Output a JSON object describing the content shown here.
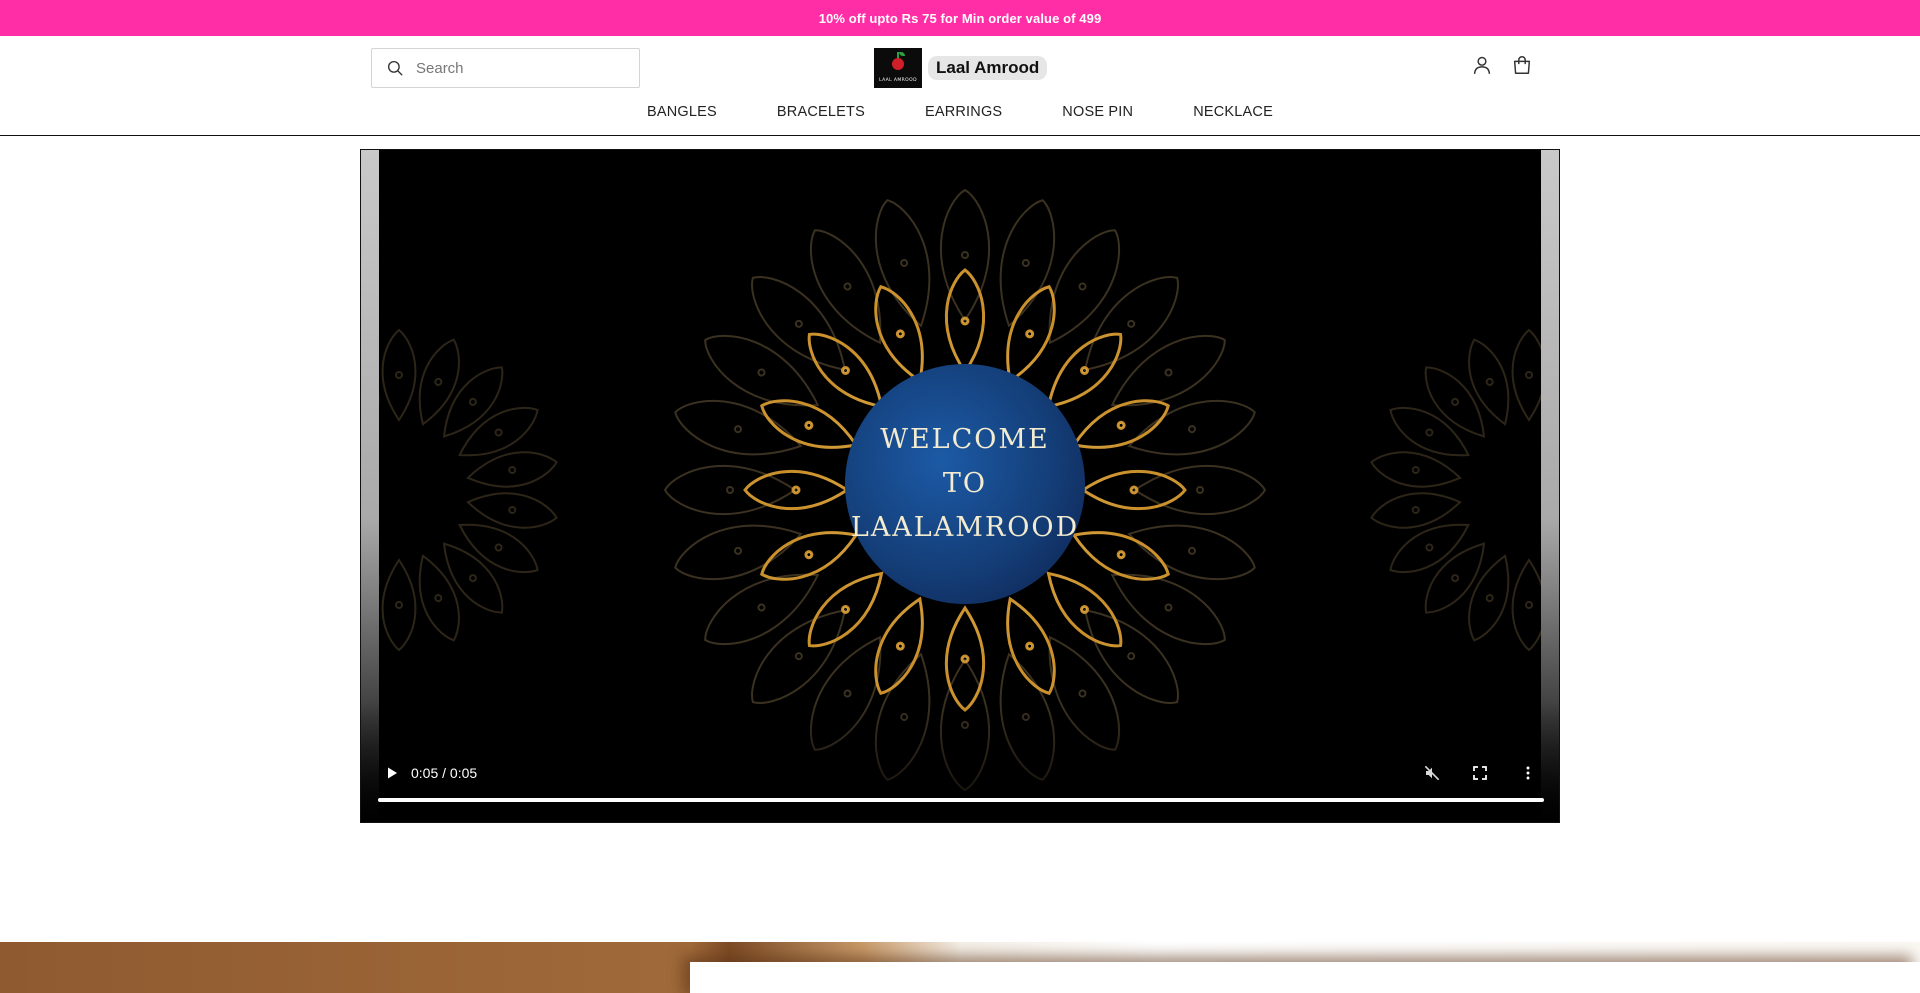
{
  "announcement": {
    "text": "10% off upto Rs 75 for Min order value of 499"
  },
  "search": {
    "placeholder": "Search"
  },
  "brand": {
    "name": "Laal Amrood",
    "logo_text": "LAAL AMROOD"
  },
  "header_icons": {
    "account": "person-icon",
    "cart": "shopping-bag-icon"
  },
  "nav": {
    "items": [
      {
        "label": "BANGLES"
      },
      {
        "label": "BRACELETS"
      },
      {
        "label": "EARRINGS"
      },
      {
        "label": "NOSE PIN"
      },
      {
        "label": "NECKLACE"
      }
    ]
  },
  "video": {
    "welcome_lines": [
      "WELCOME",
      "TO",
      "LAALAMROOD"
    ],
    "time": "0:05 / 0:05",
    "progress": 1.0,
    "controls": {
      "play": "play-icon",
      "mute": "muted-icon",
      "fullscreen": "fullscreen-icon",
      "more": "more-vertical-icon"
    }
  },
  "colors": {
    "announcement_bg": "#ff2ea6",
    "mandala_gold": "#e9b84a",
    "welcome_circle": "#143e78"
  }
}
